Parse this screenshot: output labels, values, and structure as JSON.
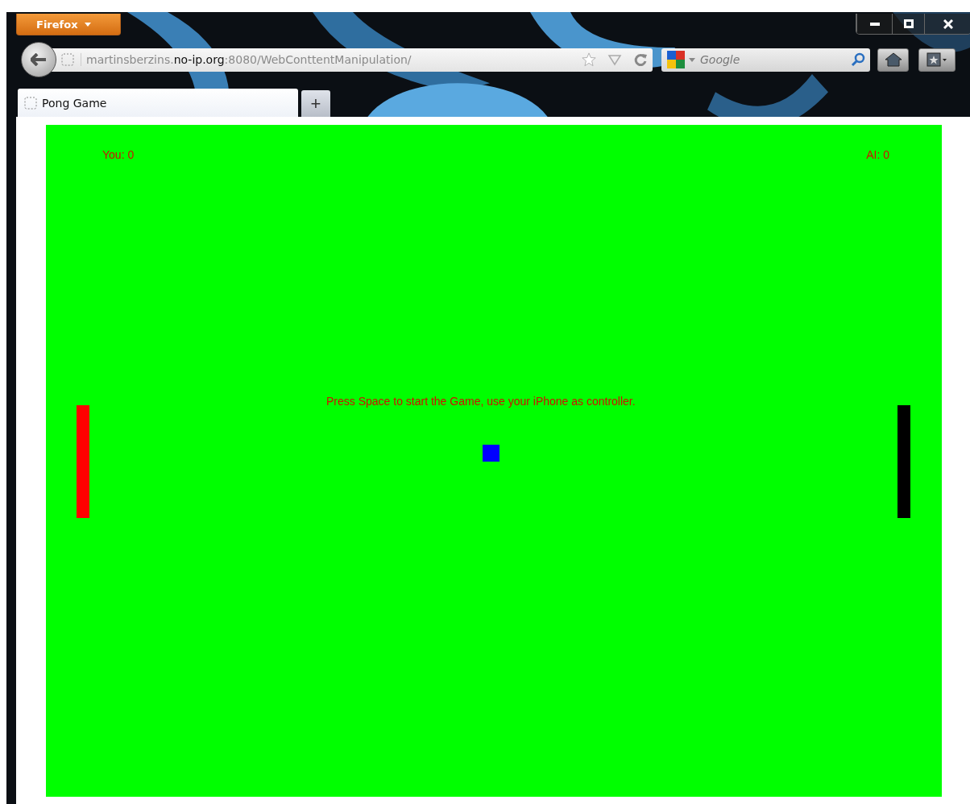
{
  "browser": {
    "menu_button": "Firefox",
    "url": "martinsberzins.**no-ip.org**:8080/WebConttentManipulation/",
    "search_placeholder": "Google",
    "tabs": [
      {
        "label": "Pong Game",
        "selected": true
      }
    ],
    "new_tab": "+"
  },
  "game": {
    "score_left": "You: 0",
    "score_right": "AI: 0",
    "message": "Press Space to start the Game, use your iPhone as controller.",
    "paddles": [
      {
        "color": "#ff0000"
      },
      {
        "color": "#000000"
      }
    ]
  }
}
